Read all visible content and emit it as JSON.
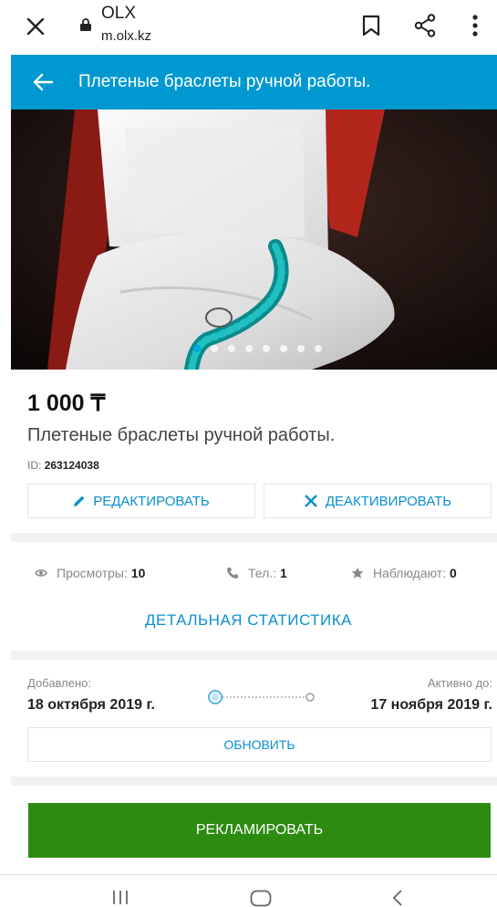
{
  "browser": {
    "site_name": "OLX",
    "url": "m.olx.kz"
  },
  "header": {
    "title": "Плетеные браслеты ручной работы."
  },
  "gallery": {
    "total_photos": 8,
    "active_index": 0,
    "accent_color": "#00a7e0"
  },
  "ad": {
    "price": "1 000 ₸",
    "title": "Плетеные браслеты ручной работы.",
    "id_label": "ID:",
    "id_value": "263124038"
  },
  "actions": {
    "edit_label": "РЕДАКТИРОВАТЬ",
    "deactivate_label": "ДЕАКТИВИРОВАТЬ",
    "refresh_label": "ОБНОВИТЬ",
    "promote_label": "РЕКЛАМИРОВАТЬ"
  },
  "stats": {
    "views_label": "Просмотры:",
    "views_value": "10",
    "phone_label": "Тел.:",
    "phone_value": "1",
    "watchers_label": "Наблюдают:",
    "watchers_value": "0",
    "details_link": "ДЕТАЛЬНАЯ СТАТИСТИКА"
  },
  "dates": {
    "added_label": "Добавлено:",
    "added_value": "18 октября 2019 г.",
    "active_until_label": "Активно до:",
    "active_until_value": "17 ноября 2019 г."
  },
  "colors": {
    "header_blue": "#0098d0",
    "link_blue": "#0a8fd0",
    "promote_green": "#2d8b12"
  }
}
